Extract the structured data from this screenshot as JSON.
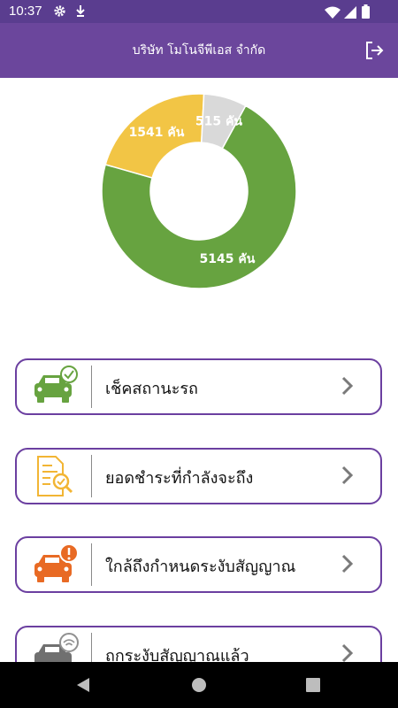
{
  "status_bar": {
    "time": "10:37",
    "icons": [
      "gear-icon",
      "download-icon",
      "wifi-icon",
      "signal-icon",
      "battery-icon"
    ]
  },
  "header": {
    "title": "บริษัท โมโนจีพีเอส จำกัด",
    "action_icon": "logout-icon"
  },
  "chart_data": {
    "type": "pie",
    "variant": "donut",
    "slices": [
      {
        "label": "5145 คัน",
        "value": 5145,
        "color": "#67a340"
      },
      {
        "label": "1541 คัน",
        "value": 1541,
        "color": "#f2c545"
      },
      {
        "label": "515 คัน",
        "value": 515,
        "color": "#d9d9d9"
      }
    ]
  },
  "menu": [
    {
      "label": "เช็คสถานะรถ",
      "icon": "car-check-icon"
    },
    {
      "label": "ยอดชำระที่กำลังจะถึง",
      "icon": "invoice-search-icon"
    },
    {
      "label": "ใกล้ถึงกำหนดระงับสัญญาณ",
      "icon": "car-alert-icon"
    },
    {
      "label": "ถูกระงับสัญญาณแล้ว",
      "icon": "car-signal-off-icon"
    }
  ],
  "nav": {
    "back": "back-icon",
    "home": "home-icon",
    "recents": "recents-icon"
  }
}
